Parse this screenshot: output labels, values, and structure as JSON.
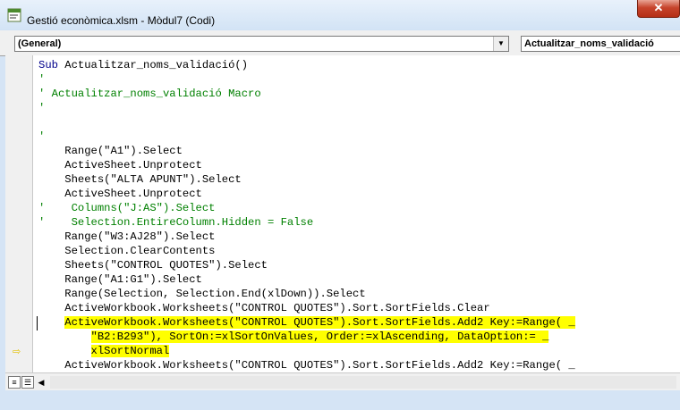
{
  "window": {
    "title": "Gestió econòmica.xlsm - Mòdul7 (Codi)",
    "close_label": "✕"
  },
  "toolbar": {
    "object_combo": "(General)",
    "procedure_combo": "Actualitzar_noms_validació",
    "dropdown_arrow": "▼"
  },
  "code_lines": [
    {
      "text": "Sub Actualitzar_noms_validació()",
      "kind": "sub"
    },
    {
      "text": "'",
      "kind": "comment"
    },
    {
      "text": "' Actualitzar_noms_validació Macro",
      "kind": "comment"
    },
    {
      "text": "'",
      "kind": "comment"
    },
    {
      "text": "",
      "kind": "code"
    },
    {
      "text": "'",
      "kind": "comment"
    },
    {
      "text": "    Range(\"A1\").Select",
      "kind": "code"
    },
    {
      "text": "    ActiveSheet.Unprotect",
      "kind": "code"
    },
    {
      "text": "    Sheets(\"ALTA APUNT\").Select",
      "kind": "code"
    },
    {
      "text": "    ActiveSheet.Unprotect",
      "kind": "code"
    },
    {
      "text": "'    Columns(\"J:AS\").Select",
      "kind": "comment"
    },
    {
      "text": "'    Selection.EntireColumn.Hidden = False",
      "kind": "comment"
    },
    {
      "text": "    Range(\"W3:AJ28\").Select",
      "kind": "code"
    },
    {
      "text": "    Selection.ClearContents",
      "kind": "code"
    },
    {
      "text": "    Sheets(\"CONTROL QUOTES\").Select",
      "kind": "code"
    },
    {
      "text": "    Range(\"A1:G1\").Select",
      "kind": "code"
    },
    {
      "text": "    Range(Selection, Selection.End(xlDown)).Select",
      "kind": "code"
    },
    {
      "text": "    ActiveWorkbook.Worksheets(\"CONTROL QUOTES\").Sort.SortFields.Clear",
      "kind": "code"
    },
    {
      "text": "ActiveWorkbook.Worksheets(\"CONTROL QUOTES\").Sort.SortFields.Add2 Key:=Range( _",
      "kind": "highlight",
      "indent": 4
    },
    {
      "text": "\"B2:B293\"), SortOn:=xlSortOnValues, Order:=xlAscending, DataOption:= _",
      "kind": "highlight",
      "indent": 8
    },
    {
      "text": "xlSortNormal",
      "kind": "highlight",
      "indent": 8
    },
    {
      "text": "    ActiveWorkbook.Worksheets(\"CONTROL QUOTES\").Sort.SortFields.Add2 Key:=Range( _",
      "kind": "code"
    }
  ],
  "icons": {
    "execution_arrow": "⇨",
    "procedure_view": "≡",
    "module_view": "☰",
    "scroll_left": "◀"
  }
}
